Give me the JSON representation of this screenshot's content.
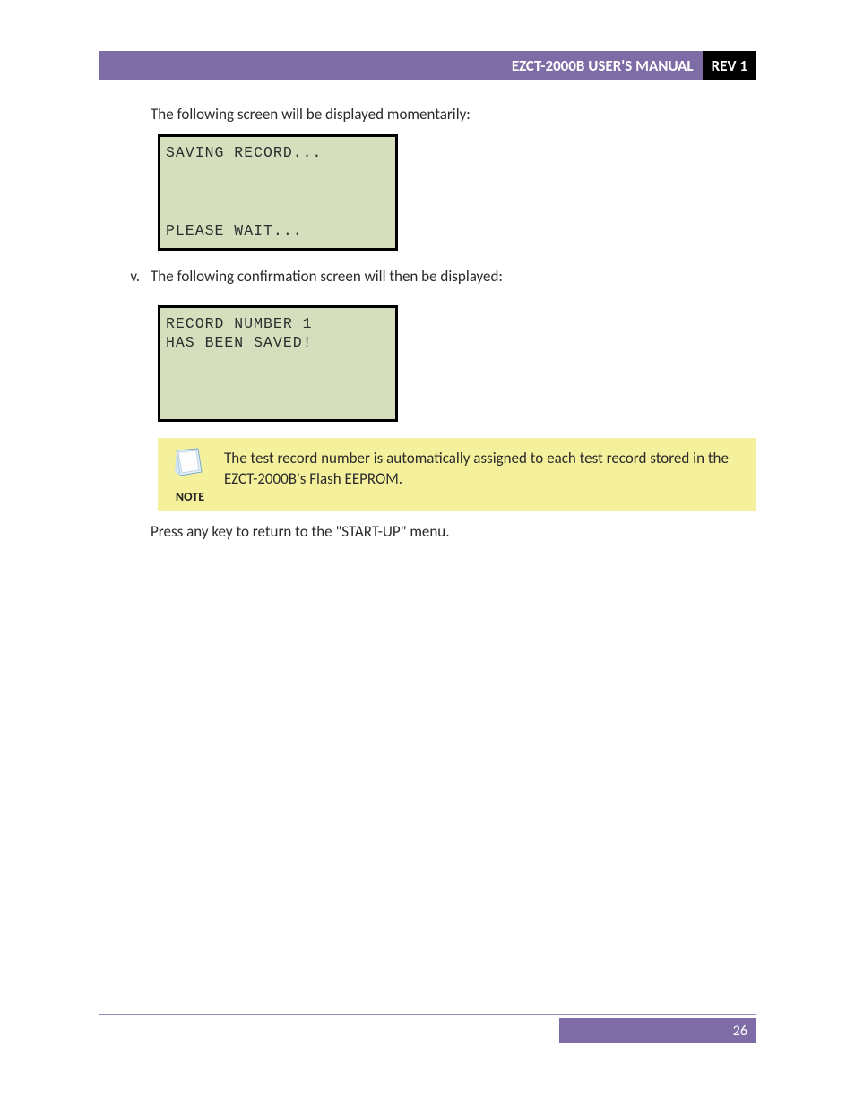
{
  "header": {
    "title": "EZCT-2000B USER'S MANUAL",
    "rev": "REV 1"
  },
  "body": {
    "intro": "The following screen will be displayed momentarily:",
    "lcd1": {
      "line1": "SAVING RECORD...",
      "line2": "PLEASE WAIT..."
    },
    "step_marker": "v.",
    "step_text": "The following confirmation screen will then be displayed:",
    "lcd2": {
      "line1": "RECORD NUMBER 1",
      "line2": " HAS BEEN SAVED!"
    },
    "note": {
      "label": "NOTE",
      "text": "The test record number is automatically assigned to each test record stored in the EZCT-2000B's Flash EEPROM."
    },
    "outro": "Press any key to return to the \"START-UP\" menu."
  },
  "footer": {
    "page": "26"
  }
}
